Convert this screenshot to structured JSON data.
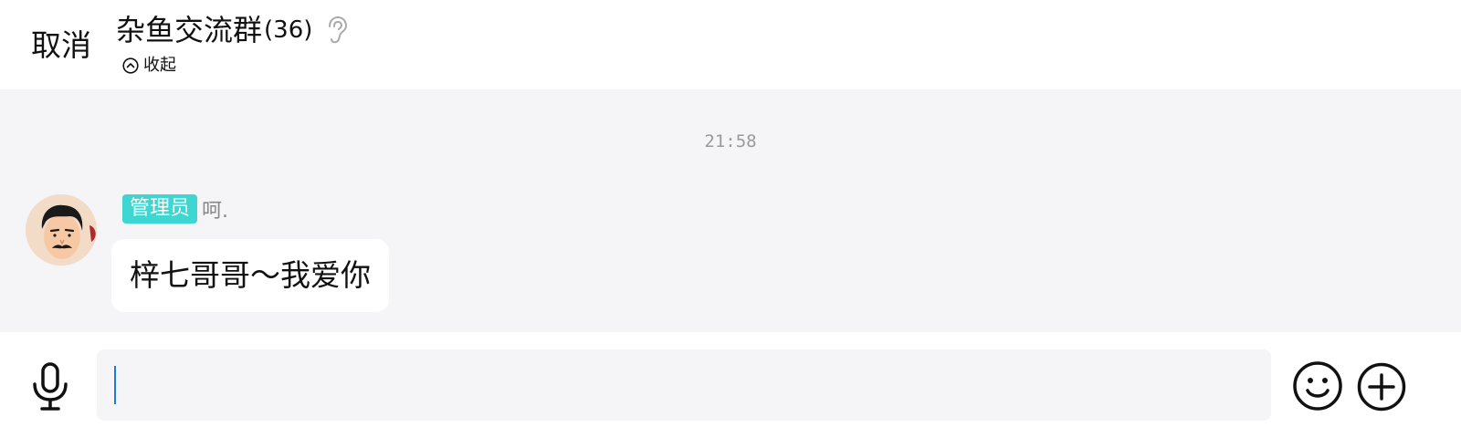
{
  "header": {
    "cancel_label": "取消",
    "group_name": "杂鱼交流群",
    "member_count": "(36)",
    "collapse_label": "收起"
  },
  "chat": {
    "timestamp": "21:58",
    "messages": [
      {
        "role_badge": "管理员",
        "sender": "呵.",
        "text": "梓七哥哥～我爱你",
        "avatar": "cartoon-man-mustache-avatar"
      }
    ]
  },
  "input": {
    "value": "",
    "placeholder": ""
  },
  "icons": {
    "ear": "ear-icon",
    "collapse": "chevron-up-circle-icon",
    "mic": "microphone-icon",
    "emoji": "smiley-icon",
    "add": "plus-circle-icon"
  },
  "colors": {
    "badge": "#3dd6d0",
    "chat_bg": "#f5f4f7",
    "caret": "#1e7bd8"
  }
}
